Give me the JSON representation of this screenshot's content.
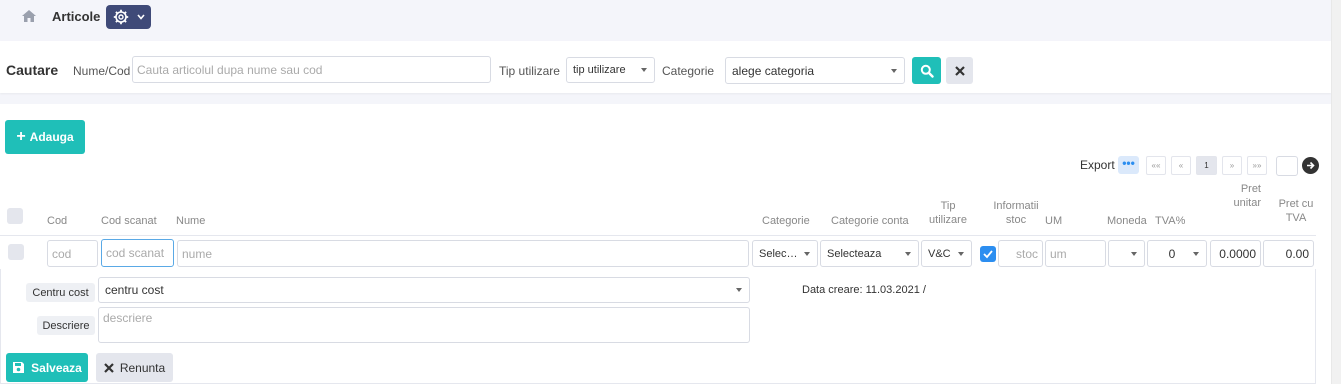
{
  "breadcrumb": {
    "title": "Articole"
  },
  "search": {
    "heading": "Cautare",
    "name_label": "Nume/Cod",
    "name_placeholder": "Cauta articolul dupa nume sau cod",
    "usage_label": "Tip utilizare",
    "usage_value": "tip utilizare",
    "category_label": "Categorie",
    "category_value": "alege categoria"
  },
  "toolbar": {
    "add_label": "Adauga",
    "export_label": "Export"
  },
  "pagination": {
    "first": "««",
    "prev": "«",
    "current": "1",
    "next": "»",
    "last": "»»",
    "page_input": ""
  },
  "table": {
    "headers": {
      "cod": "Cod",
      "cod_scanat": "Cod scanat",
      "nume": "Nume",
      "categorie": "Categorie",
      "categorie_conta": "Categorie conta",
      "tip_utilizare_1": "Tip",
      "tip_utilizare_2": "utilizare",
      "informatii_1": "Informatii",
      "informatii_2": "stoc",
      "um": "UM",
      "moneda": "Moneda",
      "tva": "TVA%",
      "pret_unitar_1": "Pret",
      "pret_unitar_2": "unitar",
      "pret_tva_1": "Pret cu",
      "pret_tva_2": "TVA"
    },
    "new_row": {
      "cod_placeholder": "cod",
      "cod_scanat_placeholder": "cod scanat",
      "nume_placeholder": "nume",
      "categorie_value": "Selec…",
      "categorie_conta_value": "Selecteaza",
      "tip_value": "V&C",
      "stoc_placeholder": "stoc",
      "um_placeholder": "um",
      "moneda_value": "",
      "tva_value": "0",
      "pret_unitar_value": "0.0000",
      "pret_tva_value": "0.00"
    }
  },
  "details": {
    "centru_label": "Centru cost",
    "centru_value": "centru cost",
    "descriere_label": "Descriere",
    "descriere_placeholder": "descriere",
    "data_creare": "Data creare: 11.03.2021 /"
  },
  "actions": {
    "save_label": "Salveaza",
    "cancel_label": "Renunta"
  },
  "colors": {
    "accent": "#1fbfb8",
    "header_button": "#3f4a78",
    "checkbox": "#2c8ef0"
  }
}
